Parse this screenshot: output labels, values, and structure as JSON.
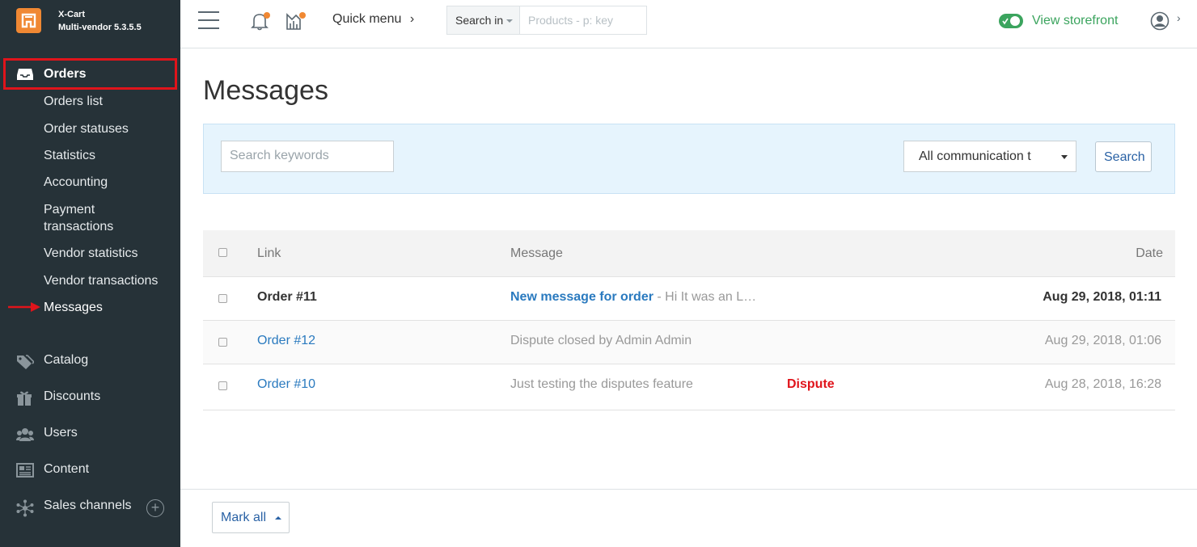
{
  "brand": {
    "name": "X-Cart",
    "version": "Multi-vendor 5.3.5.5"
  },
  "sidebar": {
    "orders_label": "Orders",
    "orders_sub": [
      "Orders list",
      "Order statuses",
      "Statistics",
      "Accounting",
      "Payment",
      "transactions",
      "Vendor statistics",
      "Vendor transactions",
      "Messages"
    ],
    "main": [
      "Catalog",
      "Discounts",
      "Users",
      "Content",
      "Sales channels"
    ]
  },
  "topbar": {
    "quick_menu": "Quick menu",
    "search_in": "Search in",
    "search_placeholder": "Products - p: key",
    "view_storefront": "View storefront"
  },
  "page": {
    "title": "Messages",
    "keywords_placeholder": "Search keywords",
    "filter_select": "All communication t",
    "search_button": "Search"
  },
  "table": {
    "headers": {
      "link": "Link",
      "message": "Message",
      "date": "Date"
    },
    "rows": [
      {
        "link": "Order #11",
        "subject": "New message for order",
        "preview": " - Hi It was an L…",
        "tag": "",
        "date": "Aug 29, 2018, 01:11"
      },
      {
        "link": "Order #12",
        "subject": "",
        "preview": "Dispute closed by Admin Admin",
        "tag": "",
        "date": "Aug 29, 2018, 01:06"
      },
      {
        "link": "Order #10",
        "subject": "",
        "preview": "Just testing the disputes feature",
        "tag": "Dispute",
        "date": "Aug 28, 2018, 16:28"
      }
    ]
  },
  "footer": {
    "mark_all": "Mark all"
  },
  "colors": {
    "sidebar": "#263238",
    "accent_orange": "#f08833",
    "highlight_red": "#e0141b",
    "link_blue": "#2a7abf",
    "storefront_green": "#3ba45e"
  }
}
